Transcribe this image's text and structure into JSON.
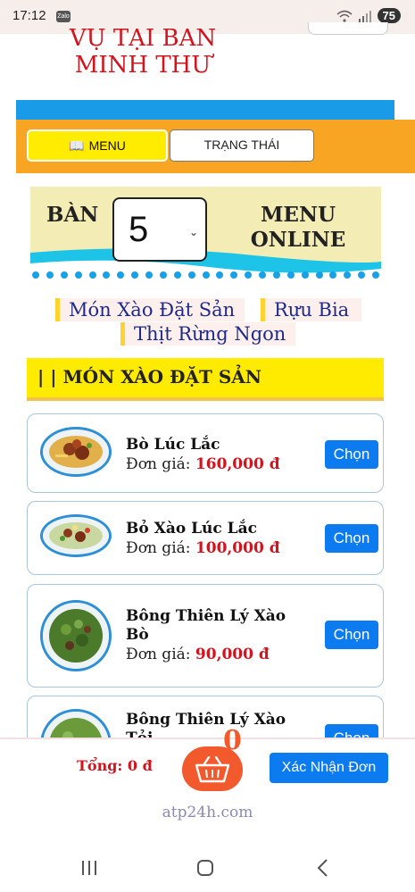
{
  "status_bar": {
    "time": "17:12",
    "zalo_icon_label": "Zalo",
    "battery": "75"
  },
  "header": {
    "title_line1": "VỤ TẠI BAN",
    "title_line2": "MINH THƯ"
  },
  "tabs": [
    {
      "label": "MENU",
      "icon": "book-icon",
      "active": true
    },
    {
      "label": "TRẠNG THÁI",
      "active": false
    }
  ],
  "table_selector": {
    "label": "BÀN",
    "value": "5",
    "menu_online_line1": "MENU",
    "menu_online_line2": "ONLINE"
  },
  "categories": [
    {
      "label": "Món Xào Đặt Sản"
    },
    {
      "label": "Rựu Bia"
    },
    {
      "label": "Thịt Rừng Ngon"
    }
  ],
  "section": {
    "title": "| | MÓN XÀO ĐẶT SẢN"
  },
  "items": [
    {
      "name": "Bò Lúc Lắc",
      "price_label": "Đơn giá:",
      "price": "160,000 đ",
      "button": "Chọn"
    },
    {
      "name": "Bỏ Xào Lúc Lắc",
      "price_label": "Đơn giá:",
      "price": "100,000 đ",
      "button": "Chọn"
    },
    {
      "name": "Bông Thiên Lý Xào Bò",
      "price_label": "Đơn giá:",
      "price": "90,000 đ",
      "button": "Chọn"
    },
    {
      "name": "Bông Thiên Lý Xào Tỏi",
      "price_label": "",
      "price": "",
      "button": "Chọn"
    }
  ],
  "cart": {
    "total": "Tổng: 0 đ",
    "count": "0",
    "confirm_label": "Xác Nhận Đơn"
  },
  "footer": {
    "link": "atp24h.com"
  },
  "colors": {
    "accent_blue": "#0d7bf0",
    "price_red": "#d2141e",
    "tab_orange": "#f7a523",
    "highlight_yellow": "#ffeb00"
  }
}
